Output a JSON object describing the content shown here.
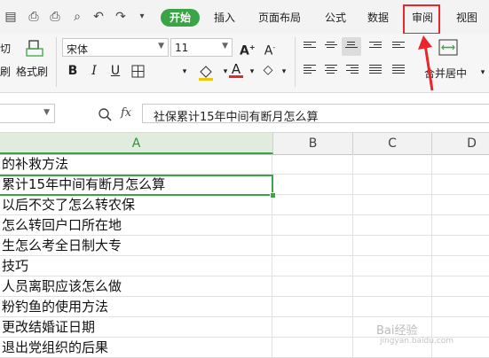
{
  "menu": {
    "tabs": [
      {
        "label": "开始"
      },
      {
        "label": "插入"
      },
      {
        "label": "页面布局"
      },
      {
        "label": "公式"
      },
      {
        "label": "数据"
      },
      {
        "label": "审阅"
      },
      {
        "label": "视图"
      }
    ],
    "annotation_color": "#e8262c",
    "active_tab_color": "#3aa447"
  },
  "ribbon": {
    "format_painter_left_partial": "切",
    "cut_partial": "刷",
    "format_painter_label": "格式刷",
    "font_name": "宋体",
    "font_size": "11",
    "font_color": "#e8262c",
    "merge_center_label": "合并居中"
  },
  "formula_bar": {
    "fx_label": "fx",
    "value": "社保累计15年中间有断月怎么算"
  },
  "columns": [
    "A",
    "B",
    "C",
    "D"
  ],
  "rows": [
    "的补救方法",
    "累计15年中间有断月怎么算",
    "以后不交了怎么转农保",
    "怎么转回户口所在地",
    "生怎么考全日制大专",
    "技巧",
    "人员离职应该怎么做",
    "粉钓鱼的使用方法",
    "更改结婚证日期",
    "退出党组织的后果"
  ],
  "watermark": {
    "brand": "Bai经验",
    "domain": "jingyan.baidu.com"
  }
}
